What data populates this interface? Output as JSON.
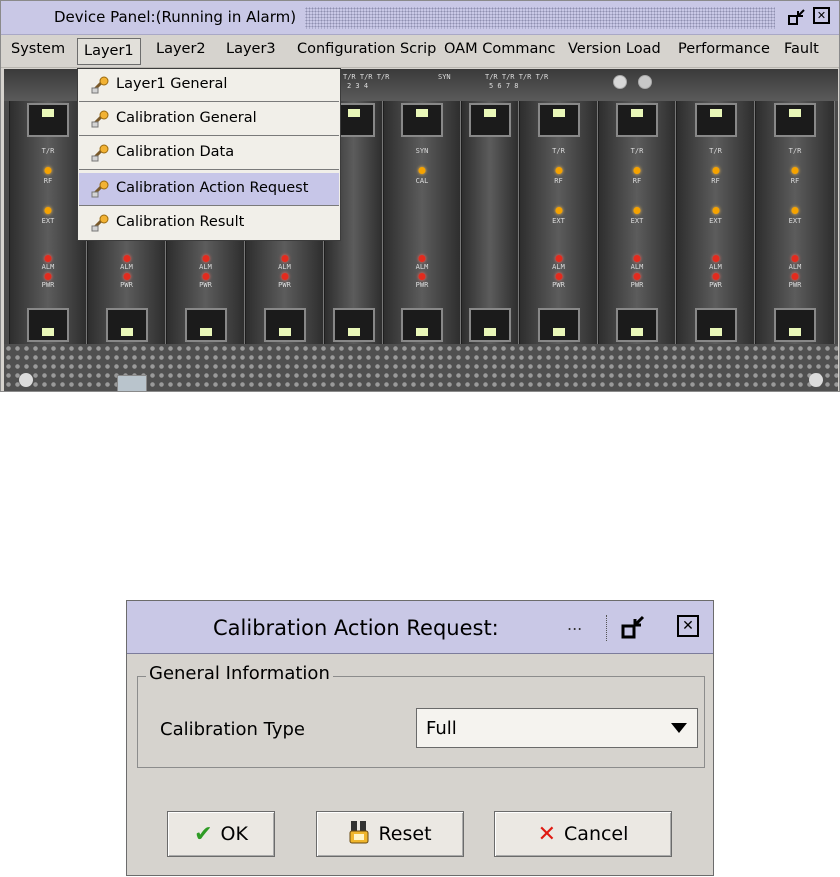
{
  "device_panel": {
    "title": "Device Panel:(Running in Alarm)",
    "controls": {
      "restore_icon": "restore-icon",
      "close_icon": "close-icon"
    },
    "menu": [
      {
        "label": "System"
      },
      {
        "label": "Layer1",
        "active": true
      },
      {
        "label": "Layer2"
      },
      {
        "label": "Layer3"
      },
      {
        "label": "Configuration Scrip"
      },
      {
        "label": "OAM Commanc"
      },
      {
        "label": "Version Load"
      },
      {
        "label": "Performance"
      },
      {
        "label": "Fault"
      }
    ],
    "dropdown": [
      {
        "label": "Layer1 General",
        "icon": "wrench-icon"
      },
      {
        "label": "Calibration General",
        "icon": "wrench-icon"
      },
      {
        "label": "Calibration Data",
        "icon": "wrench-icon"
      },
      {
        "label": "Calibration Action Request",
        "icon": "wrench-icon",
        "highlighted": true
      },
      {
        "label": "Calibration Result",
        "icon": "wrench-icon"
      }
    ],
    "chassis_top_labels": [
      "T/R T/R T/R",
      "2   3   4",
      "SYN",
      "T/R T/R T/R T/R",
      "5   6   7   8"
    ],
    "slot_labels": {
      "tr": "T/R",
      "syn": "SYN",
      "rf": "RF",
      "cal": "CAL",
      "ext": "EXT",
      "alm": "ALM",
      "pwr": "PWR"
    }
  },
  "dialog": {
    "title": "Calibration Action Request:",
    "title_ellipsis": "...",
    "group_title": "General Information",
    "field_label": "Calibration Type",
    "field_value": "Full",
    "buttons": {
      "ok": "OK",
      "reset": "Reset",
      "cancel": "Cancel"
    }
  },
  "colors": {
    "title_bar": "#c9c8e6",
    "panel": "#d6d3ce",
    "highlight": "#c7c6e8",
    "led_amber": "#f6a300",
    "led_red": "#e32b1e"
  }
}
